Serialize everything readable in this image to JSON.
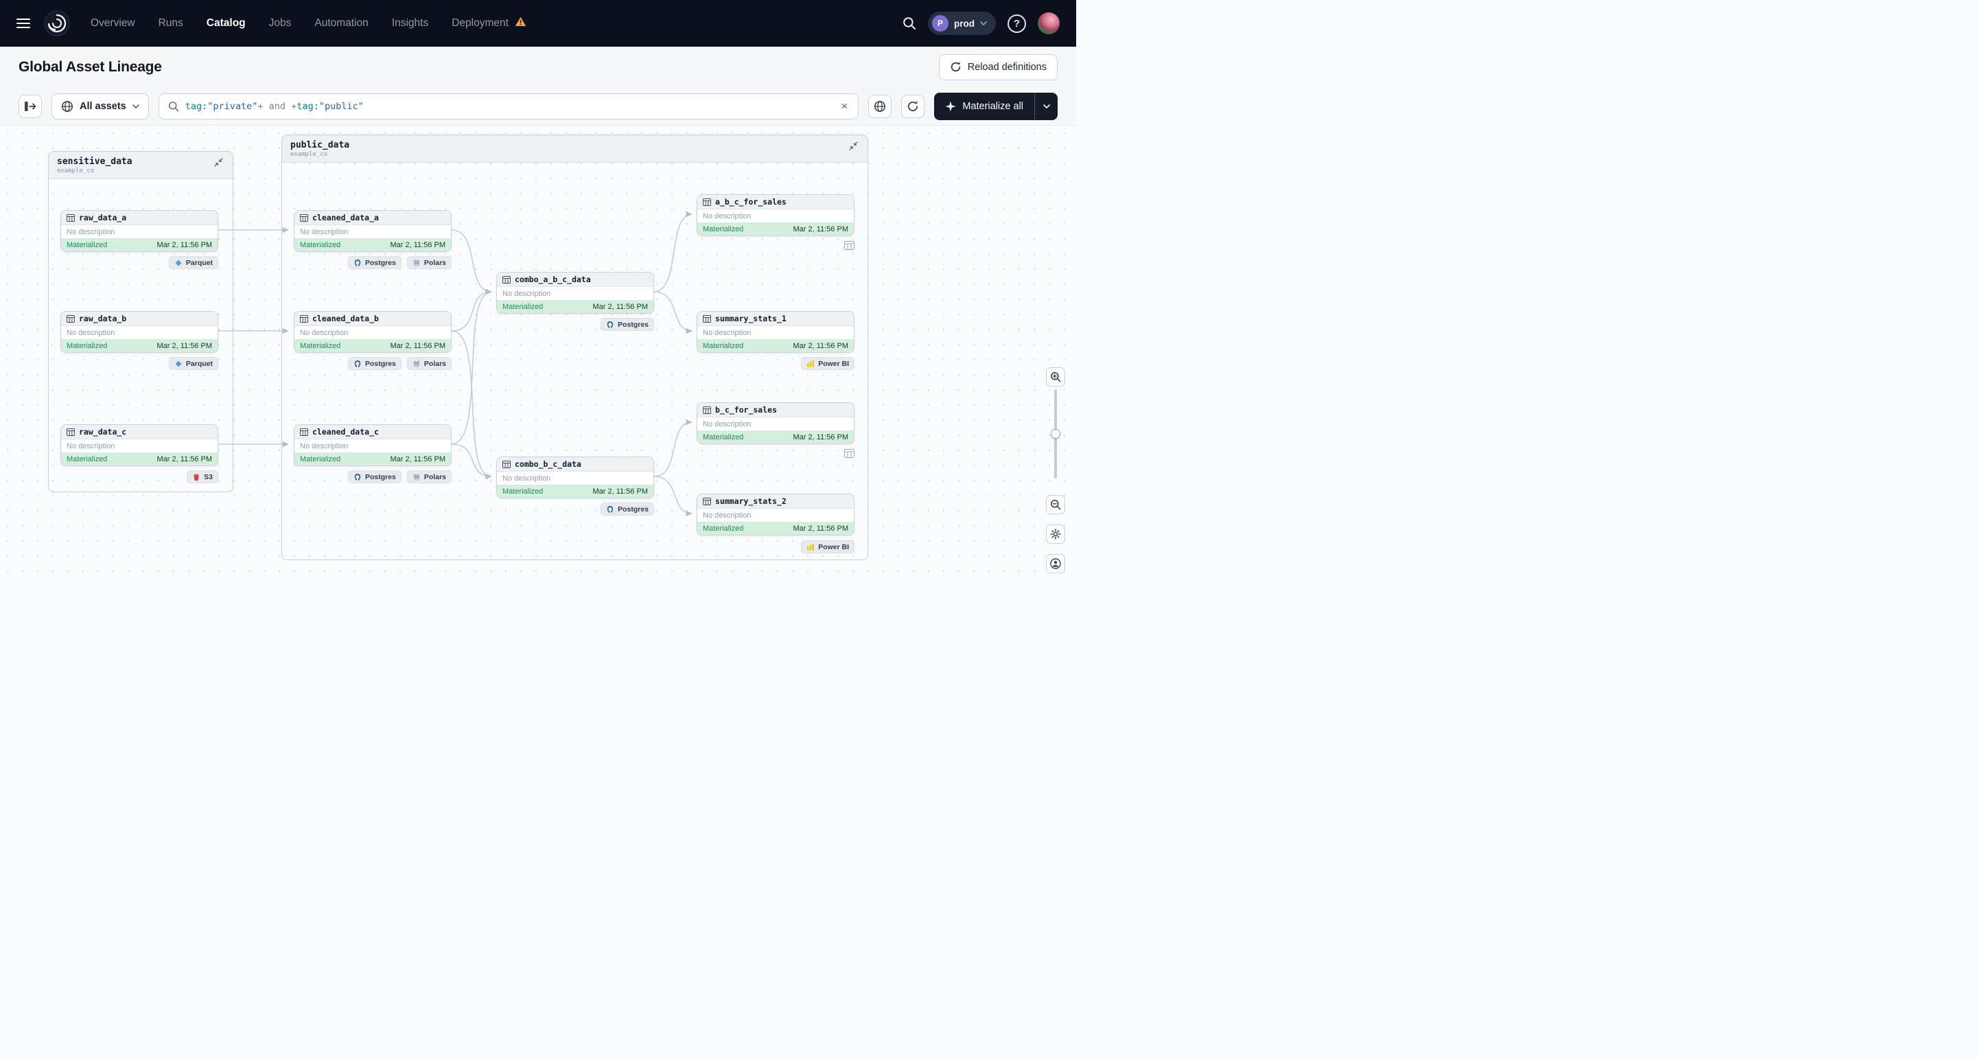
{
  "nav": {
    "items": [
      "Overview",
      "Runs",
      "Catalog",
      "Jobs",
      "Automation",
      "Insights",
      "Deployment"
    ],
    "active_item": "Catalog",
    "environment": {
      "initial": "P",
      "name": "prod"
    },
    "help_glyph": "?"
  },
  "header": {
    "title": "Global Asset Lineage",
    "reload_button": "Reload definitions"
  },
  "toolbar": {
    "scope_label": "All assets",
    "materialize_label": "Materialize all",
    "clear_glyph": "×",
    "search_tokens": [
      {
        "text": "tag:"
      },
      {
        "text": "\"private\""
      },
      {
        "text": "+"
      },
      {
        "text": " and "
      },
      {
        "text": "+"
      },
      {
        "text": "tag:"
      },
      {
        "text": "\"public\""
      }
    ]
  },
  "canvas": {
    "groups": [
      {
        "name": "sensitive_data",
        "subtitle": "example_co"
      },
      {
        "name": "public_data",
        "subtitle": "example_co"
      }
    ],
    "nodes": [
      {
        "name": "raw_data_a",
        "description": "No description",
        "status": "Materialized",
        "timestamp": "Mar 2, 11:56 PM",
        "kinds": [
          {
            "icon": "parquet",
            "label": "Parquet"
          }
        ]
      },
      {
        "name": "raw_data_b",
        "description": "No description",
        "status": "Materialized",
        "timestamp": "Mar 2, 11:56 PM",
        "kinds": [
          {
            "icon": "parquet",
            "label": "Parquet"
          }
        ]
      },
      {
        "name": "raw_data_c",
        "description": "No description",
        "status": "Materialized",
        "timestamp": "Mar 2, 11:56 PM",
        "kinds": [
          {
            "icon": "s3",
            "label": "S3"
          }
        ]
      },
      {
        "name": "cleaned_data_a",
        "description": "No description",
        "status": "Materialized",
        "timestamp": "Mar 2, 11:56 PM",
        "kinds": [
          {
            "icon": "postgres",
            "label": "Postgres"
          },
          {
            "icon": "polars",
            "label": "Polars"
          }
        ]
      },
      {
        "name": "cleaned_data_b",
        "description": "No description",
        "status": "Materialized",
        "timestamp": "Mar 2, 11:56 PM",
        "kinds": [
          {
            "icon": "postgres",
            "label": "Postgres"
          },
          {
            "icon": "polars",
            "label": "Polars"
          }
        ]
      },
      {
        "name": "cleaned_data_c",
        "description": "No description",
        "status": "Materialized",
        "timestamp": "Mar 2, 11:56 PM",
        "kinds": [
          {
            "icon": "postgres",
            "label": "Postgres"
          },
          {
            "icon": "polars",
            "label": "Polars"
          }
        ]
      },
      {
        "name": "combo_a_b_c_data",
        "description": "No description",
        "status": "Materialized",
        "timestamp": "Mar 2, 11:56 PM",
        "kinds": [
          {
            "icon": "postgres",
            "label": "Postgres"
          }
        ]
      },
      {
        "name": "combo_b_c_data",
        "description": "No description",
        "status": "Materialized",
        "timestamp": "Mar 2, 11:56 PM",
        "kinds": [
          {
            "icon": "postgres",
            "label": "Postgres"
          }
        ]
      },
      {
        "name": "a_b_c_for_sales",
        "description": "No description",
        "status": "Materialized",
        "timestamp": "Mar 2, 11:56 PM",
        "kinds": [
          {
            "icon": "csv"
          }
        ]
      },
      {
        "name": "summary_stats_1",
        "description": "No description",
        "status": "Materialized",
        "timestamp": "Mar 2, 11:56 PM",
        "kinds": [
          {
            "icon": "powerbi",
            "label": "Power BI"
          }
        ]
      },
      {
        "name": "b_c_for_sales",
        "description": "No description",
        "status": "Materialized",
        "timestamp": "Mar 2, 11:56 PM",
        "kinds": [
          {
            "icon": "csv"
          }
        ]
      },
      {
        "name": "summary_stats_2",
        "description": "No description",
        "status": "Materialized",
        "timestamp": "Mar 2, 11:56 PM",
        "kinds": [
          {
            "icon": "powerbi",
            "label": "Power BI"
          }
        ]
      }
    ]
  },
  "colors": {
    "nav_bg": "#0c101d",
    "accent_dark": "#141a28",
    "materialized_bg": "#d5efdf",
    "materialized_text": "#1f8a58",
    "warning": "#f2a33c"
  }
}
